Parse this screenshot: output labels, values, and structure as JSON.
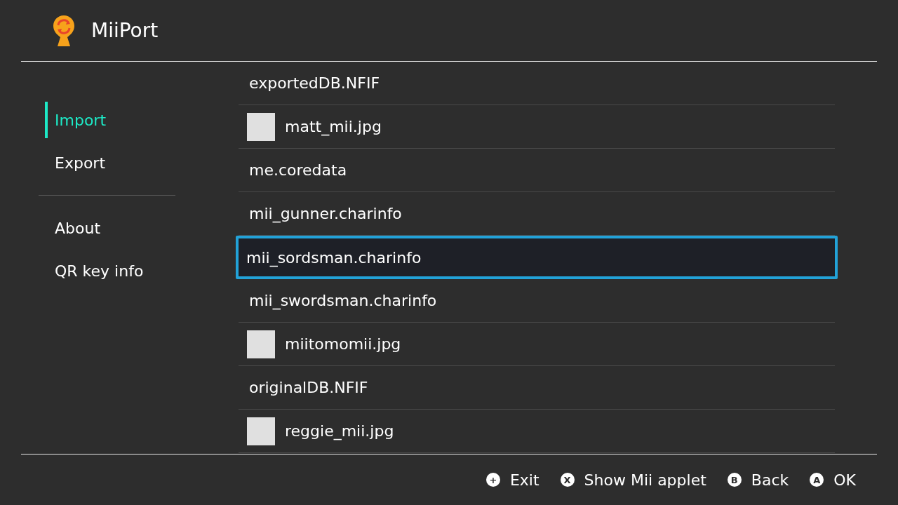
{
  "app": {
    "title": "MiiPort"
  },
  "sidebar": {
    "groups": [
      [
        {
          "label": "Import",
          "selected": true
        },
        {
          "label": "Export",
          "selected": false
        }
      ],
      [
        {
          "label": "About",
          "selected": false
        },
        {
          "label": "QR key info",
          "selected": false
        }
      ]
    ]
  },
  "files": [
    {
      "name": "exportedDB.NFIF",
      "kind": "plain",
      "selected": false
    },
    {
      "name": "matt_mii.jpg",
      "kind": "image",
      "selected": false
    },
    {
      "name": "me.coredata",
      "kind": "plain",
      "selected": false
    },
    {
      "name": "mii_gunner.charinfo",
      "kind": "plain",
      "selected": false
    },
    {
      "name": "mii_sordsman.charinfo",
      "kind": "plain",
      "selected": true
    },
    {
      "name": "mii_swordsman.charinfo",
      "kind": "plain",
      "selected": false
    },
    {
      "name": "miitomomii.jpg",
      "kind": "image",
      "selected": false
    },
    {
      "name": "originalDB.NFIF",
      "kind": "plain",
      "selected": false
    },
    {
      "name": "reggie_mii.jpg",
      "kind": "image",
      "selected": false
    }
  ],
  "footer": [
    {
      "glyph": "+",
      "label": "Exit"
    },
    {
      "glyph": "X",
      "label": "Show Mii applet"
    },
    {
      "glyph": "B",
      "label": "Back"
    },
    {
      "glyph": "A",
      "label": "OK"
    }
  ]
}
